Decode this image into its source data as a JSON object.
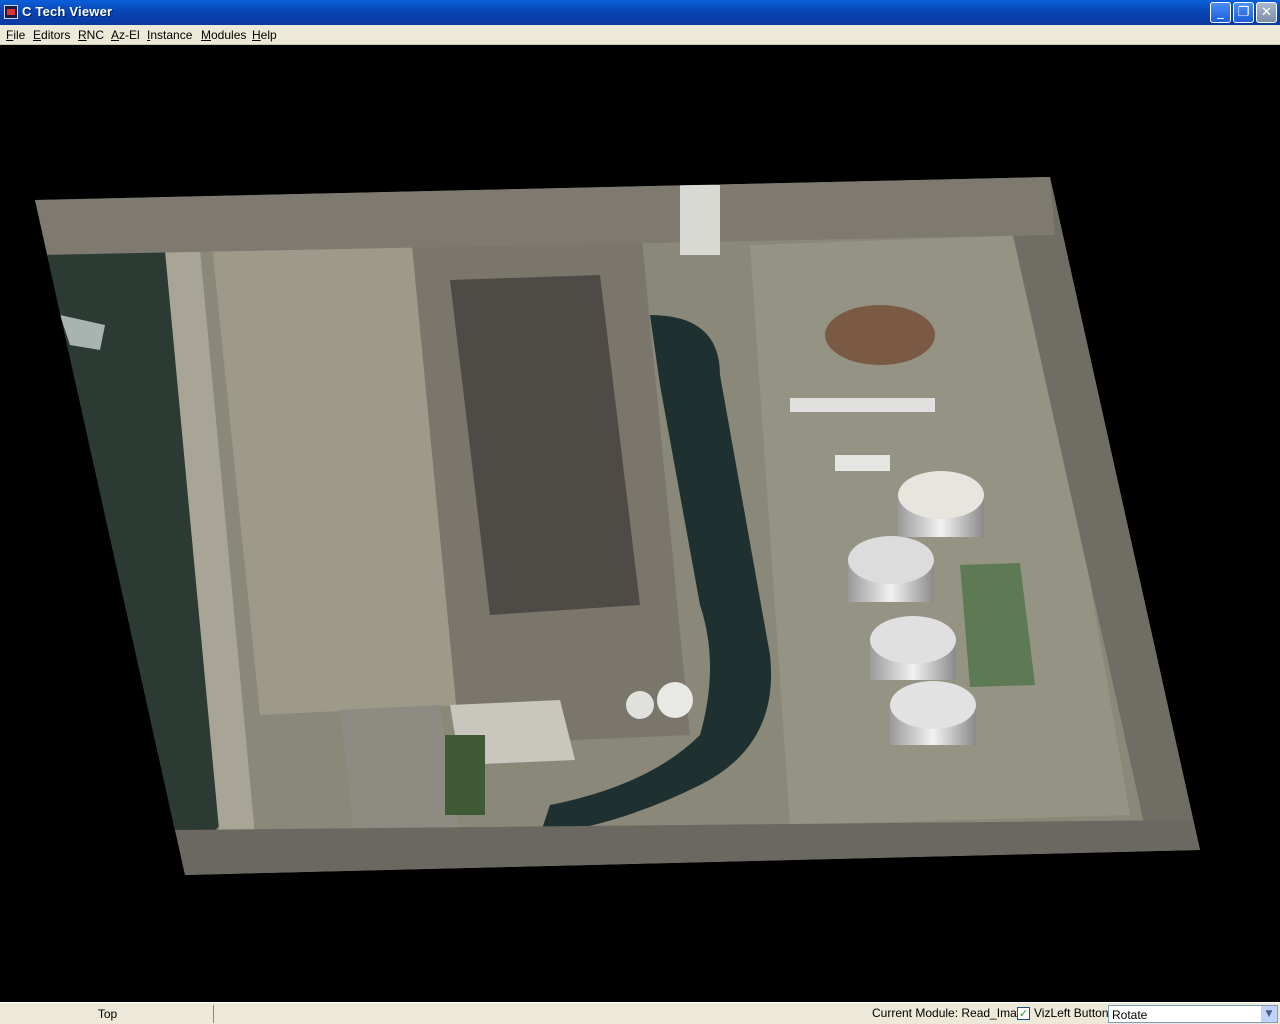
{
  "window": {
    "title": "C Tech Viewer",
    "minimize_glyph": "_",
    "maximize_glyph": "❐",
    "close_glyph": "✕"
  },
  "menu": {
    "items": [
      {
        "label": "File",
        "accel": "F",
        "rest": "ile"
      },
      {
        "label": "Editors",
        "accel": "E",
        "rest": "ditors"
      },
      {
        "label": "RNC",
        "accel": "R",
        "rest": "NC"
      },
      {
        "label": "Az-El",
        "accel": "A",
        "rest": "z-El"
      },
      {
        "label": "Instance",
        "accel": "I",
        "rest": "nstance"
      },
      {
        "label": "Modules",
        "accel": "M",
        "rest": "odules"
      },
      {
        "label": "Help",
        "accel": "H",
        "rest": "elp"
      }
    ]
  },
  "viewport": {
    "description_icon": "aerial-imagery-plane"
  },
  "status": {
    "view": "Top",
    "current_module": "Current Module: Read_Image",
    "viz_checked": "✓",
    "viz_label": "VizLeft Button",
    "mode_value": "Rotate",
    "mode_arrow": "▼"
  },
  "colors": {
    "titlebar": "#0842b0",
    "menubar": "#ece9d8",
    "background": "#000000"
  }
}
